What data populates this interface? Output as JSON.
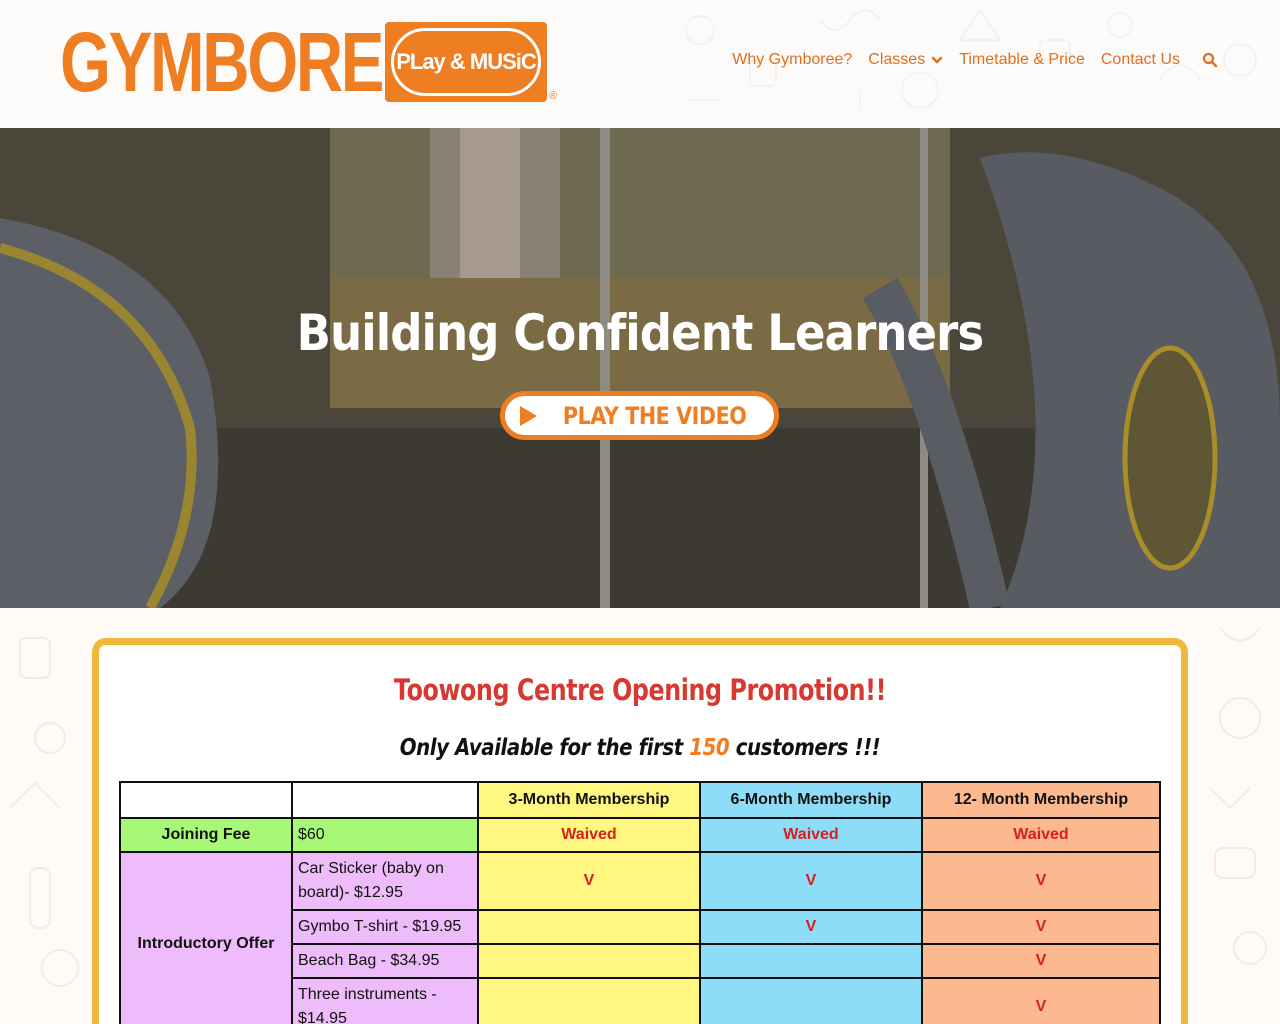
{
  "brand": {
    "name": "GYMBOREE",
    "badge": "PLay & MUSiC",
    "registered": "®",
    "color": "#ef7d22"
  },
  "nav": {
    "items": [
      {
        "label": "Why Gymboree?",
        "icon": null
      },
      {
        "label": "Classes",
        "icon": "chevron-down-icon"
      },
      {
        "label": "Timetable & Price",
        "icon": null
      },
      {
        "label": "Contact Us",
        "icon": null
      }
    ],
    "search_icon": "search-icon"
  },
  "hero": {
    "title": "Building Confident Learners",
    "button_label": "PLAY THE VIDEO",
    "button_icon": "play-icon"
  },
  "promo": {
    "title": "Toowong Centre Opening Promotion!!",
    "subtitle_pre": "Only Available for the first ",
    "subtitle_num": "150",
    "subtitle_post": " customers !!!",
    "border_color": "#f0b83a",
    "title_color": "#d8382f"
  },
  "table": {
    "headers": [
      "",
      "",
      "3-Month Membership",
      "6-Month Membership",
      "12- Month Membership"
    ],
    "joining_fee": {
      "label": "Joining Fee",
      "price": "$60",
      "cells": [
        "Waived",
        "Waived",
        "Waived"
      ]
    },
    "intro_label": "Introductory Offer",
    "intro_items": [
      {
        "item": "Car Sticker (baby on board)- $12.95",
        "cells": [
          "V",
          "V",
          "V"
        ]
      },
      {
        "item": "Gymbo T-shirt - $19.95",
        "cells": [
          "",
          "V",
          "V"
        ]
      },
      {
        "item": "Beach Bag - $34.95",
        "cells": [
          "",
          "",
          "V"
        ]
      },
      {
        "item": "Three instruments - $14.95",
        "cells": [
          "",
          "",
          "V"
        ]
      }
    ],
    "colors": {
      "three_month": "#fff780",
      "six_month": "#8dddf8",
      "twelve_month": "#fcb88f",
      "joining": "#a8f878",
      "intro": "#eebcfb"
    }
  }
}
